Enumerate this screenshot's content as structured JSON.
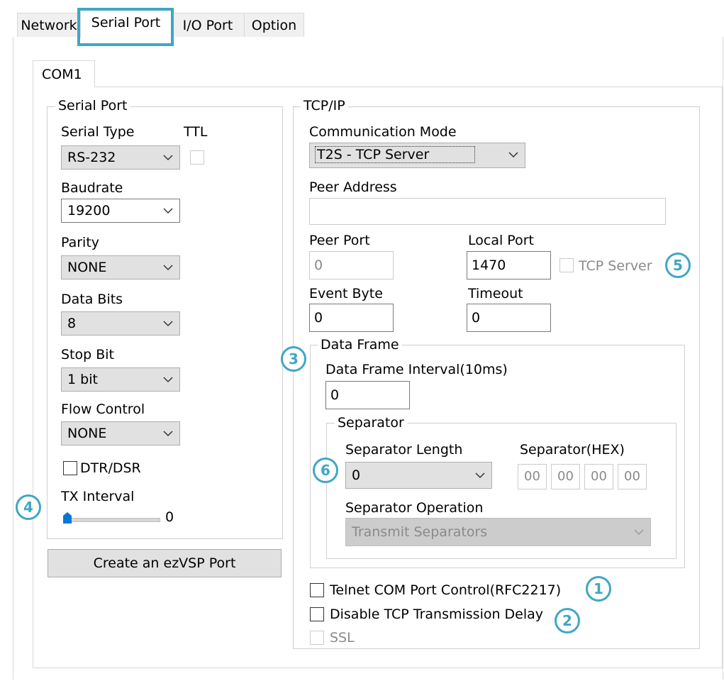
{
  "tabs": [
    {
      "label": "Network"
    },
    {
      "label": "Serial Port"
    },
    {
      "label": "I/O Port"
    },
    {
      "label": "Option"
    }
  ],
  "com_tab": {
    "label": "COM1"
  },
  "serial_port": {
    "group_title": "Serial Port",
    "serial_type_label": "Serial Type",
    "serial_type_value": "RS-232",
    "ttl_label": "TTL",
    "baudrate_label": "Baudrate",
    "baudrate_value": "19200",
    "parity_label": "Parity",
    "parity_value": "NONE",
    "data_bits_label": "Data Bits",
    "data_bits_value": "8",
    "stop_bit_label": "Stop Bit",
    "stop_bit_value": "1 bit",
    "flow_control_label": "Flow Control",
    "flow_control_value": "NONE",
    "dtr_dsr_label": "DTR/DSR",
    "tx_interval_label": "TX Interval",
    "tx_interval_value": "0"
  },
  "create_button_label": "Create an ezVSP Port",
  "tcpip": {
    "group_title": "TCP/IP",
    "comm_mode_label": "Communication Mode",
    "comm_mode_value": "T2S - TCP Server",
    "peer_address_label": "Peer Address",
    "peer_address_value": "",
    "peer_port_label": "Peer Port",
    "peer_port_value": "0",
    "local_port_label": "Local Port",
    "local_port_value": "1470",
    "tcp_server_label": "TCP Server",
    "event_byte_label": "Event Byte",
    "event_byte_value": "0",
    "timeout_label": "Timeout",
    "timeout_value": "0"
  },
  "data_frame": {
    "group_title": "Data Frame",
    "interval_label": "Data Frame Interval(10ms)",
    "interval_value": "0",
    "separator_group_title": "Separator",
    "separator_length_label": "Separator Length",
    "separator_length_value": "0",
    "separator_hex_label": "Separator(HEX)",
    "separator_hex_values": [
      "00",
      "00",
      "00",
      "00"
    ],
    "separator_operation_label": "Separator Operation",
    "separator_operation_value": "Transmit Separators"
  },
  "options": {
    "telnet_label": "Telnet COM Port Control(RFC2217)",
    "disable_delay_label": "Disable TCP Transmission Delay",
    "ssl_label": "SSL"
  },
  "callouts": [
    "1",
    "2",
    "3",
    "4",
    "5",
    "6"
  ],
  "colors": {
    "callout": "#3fa7c4",
    "tab_highlight": "#3fa7c4"
  }
}
